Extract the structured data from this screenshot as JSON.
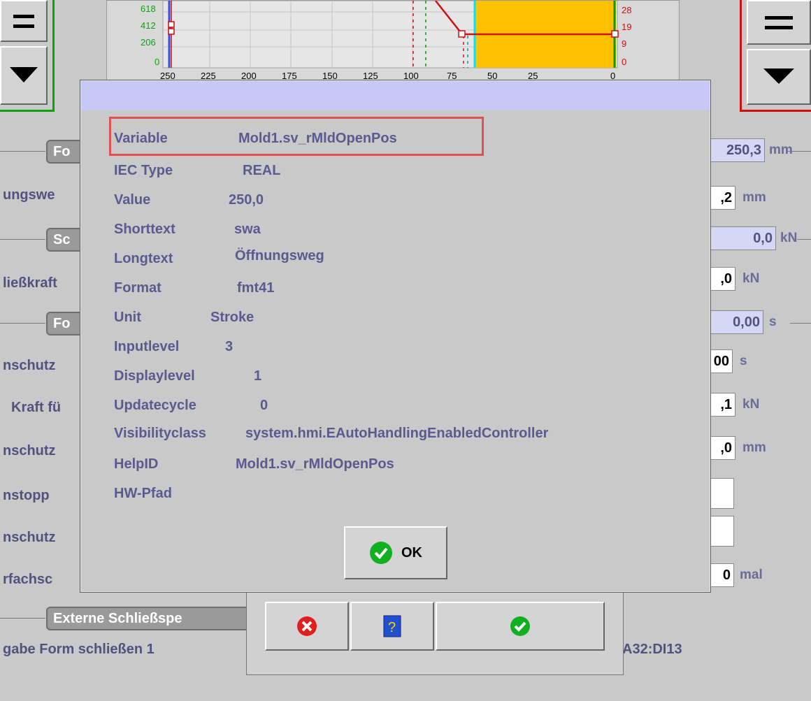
{
  "chart": {
    "left_ticks": [
      "618",
      "412",
      "206",
      "0"
    ],
    "right_ticks": [
      "28",
      "19",
      "9",
      "0"
    ],
    "x_ticks": [
      "250",
      "225",
      "200",
      "175",
      "150",
      "125",
      "100",
      "75",
      "50",
      "25",
      "0"
    ]
  },
  "form": {
    "tab1": "Fo",
    "tab2": "Sc",
    "tab3": "Fo",
    "tab4": "Externe Schließspe",
    "labels": [
      "ungswe",
      "ließkraft",
      "nschutz",
      "Kraft fü",
      "nschutz",
      "nstopp",
      "nschutz",
      "rfachsc"
    ],
    "bottom_label": "gabe Form schließen 1",
    "bottom_right": "A32:DI13"
  },
  "right_fields": {
    "f1": {
      "value": "250,3",
      "unit": "mm"
    },
    "f2": {
      "value": ",2",
      "unit": "mm"
    },
    "f3": {
      "value": "0,0",
      "unit": "kN"
    },
    "f4": {
      "value": ",0",
      "unit": "kN"
    },
    "f5": {
      "value": "0,00",
      "unit": "s"
    },
    "f6": {
      "value": "00",
      "unit": "s"
    },
    "f7": {
      "value": ",1",
      "unit": "kN"
    },
    "f8": {
      "value": ",0",
      "unit": "mm"
    },
    "f9": {
      "value": "",
      "unit": ""
    },
    "f10": {
      "value": "",
      "unit": ""
    },
    "f11": {
      "value": "0",
      "unit": "mal"
    }
  },
  "dialog": {
    "rows": [
      {
        "label": "Variable",
        "value": "Mold1.sv_rMldOpenPos"
      },
      {
        "label": "IEC Type",
        "value": "REAL"
      },
      {
        "label": "Value",
        "value": "250,0"
      },
      {
        "label": "Shorttext",
        "value": "swa"
      },
      {
        "label": "Longtext",
        "value": "Öffnungsweg"
      },
      {
        "label": "Format",
        "value": "fmt41"
      },
      {
        "label": "Unit",
        "value": "Stroke"
      },
      {
        "label": "Inputlevel",
        "value": "3"
      },
      {
        "label": "Displaylevel",
        "value": "1"
      },
      {
        "label": "Updatecycle",
        "value": "0"
      },
      {
        "label": "Visibilityclass",
        "value": "system.hmi.EAutoHandlingEnabledController"
      },
      {
        "label": "HelpID",
        "value": "Mold1.sv_rMldOpenPos"
      },
      {
        "label": "HW-Pfad",
        "value": ""
      }
    ],
    "ok_label": "OK"
  },
  "colors": {
    "highlight_box": "#e05050",
    "dialog_header": "#c8c8f5",
    "label_text": "#5a5a90",
    "chart_fill": "#ffc000"
  }
}
